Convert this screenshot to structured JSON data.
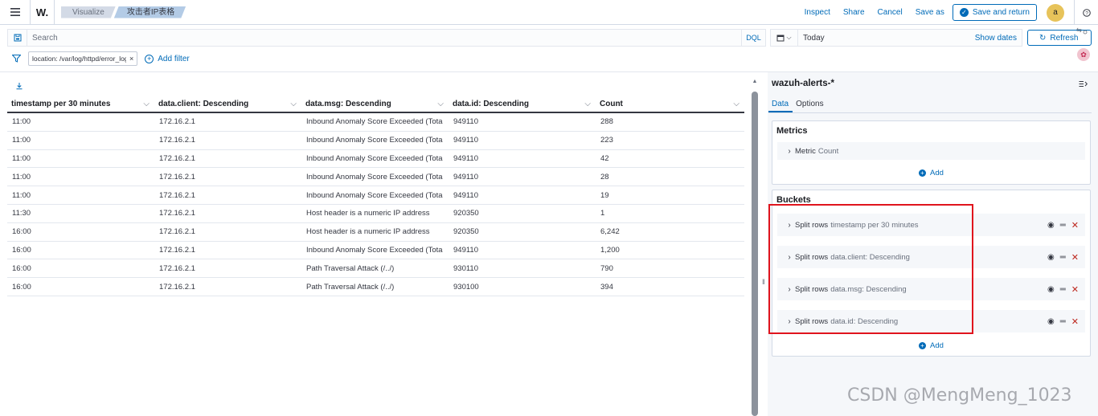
{
  "header": {
    "logo": "W.",
    "breadcrumbs": [
      "Visualize",
      "攻击者IP表格"
    ],
    "actions": [
      "Inspect",
      "Share",
      "Cancel",
      "Save as"
    ],
    "save_and_return": "Save and return",
    "avatar": "a"
  },
  "query": {
    "placeholder": "Search",
    "language": "DQL",
    "date_label": "Today",
    "show_dates": "Show dates",
    "refresh": "Refresh"
  },
  "filters": {
    "pills": [
      "location: /var/log/httpd/error_log"
    ],
    "add_filter": "Add filter"
  },
  "table": {
    "columns": [
      "timestamp per 30 minutes",
      "data.client: Descending",
      "data.msg: Descending",
      "data.id: Descending",
      "Count"
    ],
    "rows": [
      [
        "11:00",
        "172.16.2.1",
        "Inbound Anomaly Score Exceeded (Tota",
        "949110",
        "288"
      ],
      [
        "11:00",
        "172.16.2.1",
        "Inbound Anomaly Score Exceeded (Tota",
        "949110",
        "223"
      ],
      [
        "11:00",
        "172.16.2.1",
        "Inbound Anomaly Score Exceeded (Tota",
        "949110",
        "42"
      ],
      [
        "11:00",
        "172.16.2.1",
        "Inbound Anomaly Score Exceeded (Tota",
        "949110",
        "28"
      ],
      [
        "11:00",
        "172.16.2.1",
        "Inbound Anomaly Score Exceeded (Tota",
        "949110",
        "19"
      ],
      [
        "11:30",
        "172.16.2.1",
        "Host header is a numeric IP address",
        "920350",
        "1"
      ],
      [
        "16:00",
        "172.16.2.1",
        "Host header is a numeric IP address",
        "920350",
        "6,242"
      ],
      [
        "16:00",
        "172.16.2.1",
        "Inbound Anomaly Score Exceeded (Tota",
        "949110",
        "1,200"
      ],
      [
        "16:00",
        "172.16.2.1",
        "Path Traversal Attack (/../)",
        "930110",
        "790"
      ],
      [
        "16:00",
        "172.16.2.1",
        "Path Traversal Attack (/../)",
        "930100",
        "394"
      ]
    ]
  },
  "sidebar": {
    "index_pattern": "wazuh-alerts-*",
    "tabs": [
      "Data",
      "Options"
    ],
    "metrics": {
      "title": "Metrics",
      "items": [
        {
          "label": "Metric",
          "sub": "Count"
        }
      ],
      "add": "Add"
    },
    "buckets": {
      "title": "Buckets",
      "items": [
        {
          "label": "Split rows",
          "sub": "timestamp per 30 minutes"
        },
        {
          "label": "Split rows",
          "sub": "data.client: Descending"
        },
        {
          "label": "Split rows",
          "sub": "data.msg: Descending"
        },
        {
          "label": "Split rows",
          "sub": "data.id: Descending"
        }
      ],
      "add": "Add"
    }
  },
  "watermark": "CSDN @MengMeng_1023",
  "colors": {
    "accent": "#006bb8",
    "danger": "#bd271e",
    "highlight": "#e0141d"
  }
}
